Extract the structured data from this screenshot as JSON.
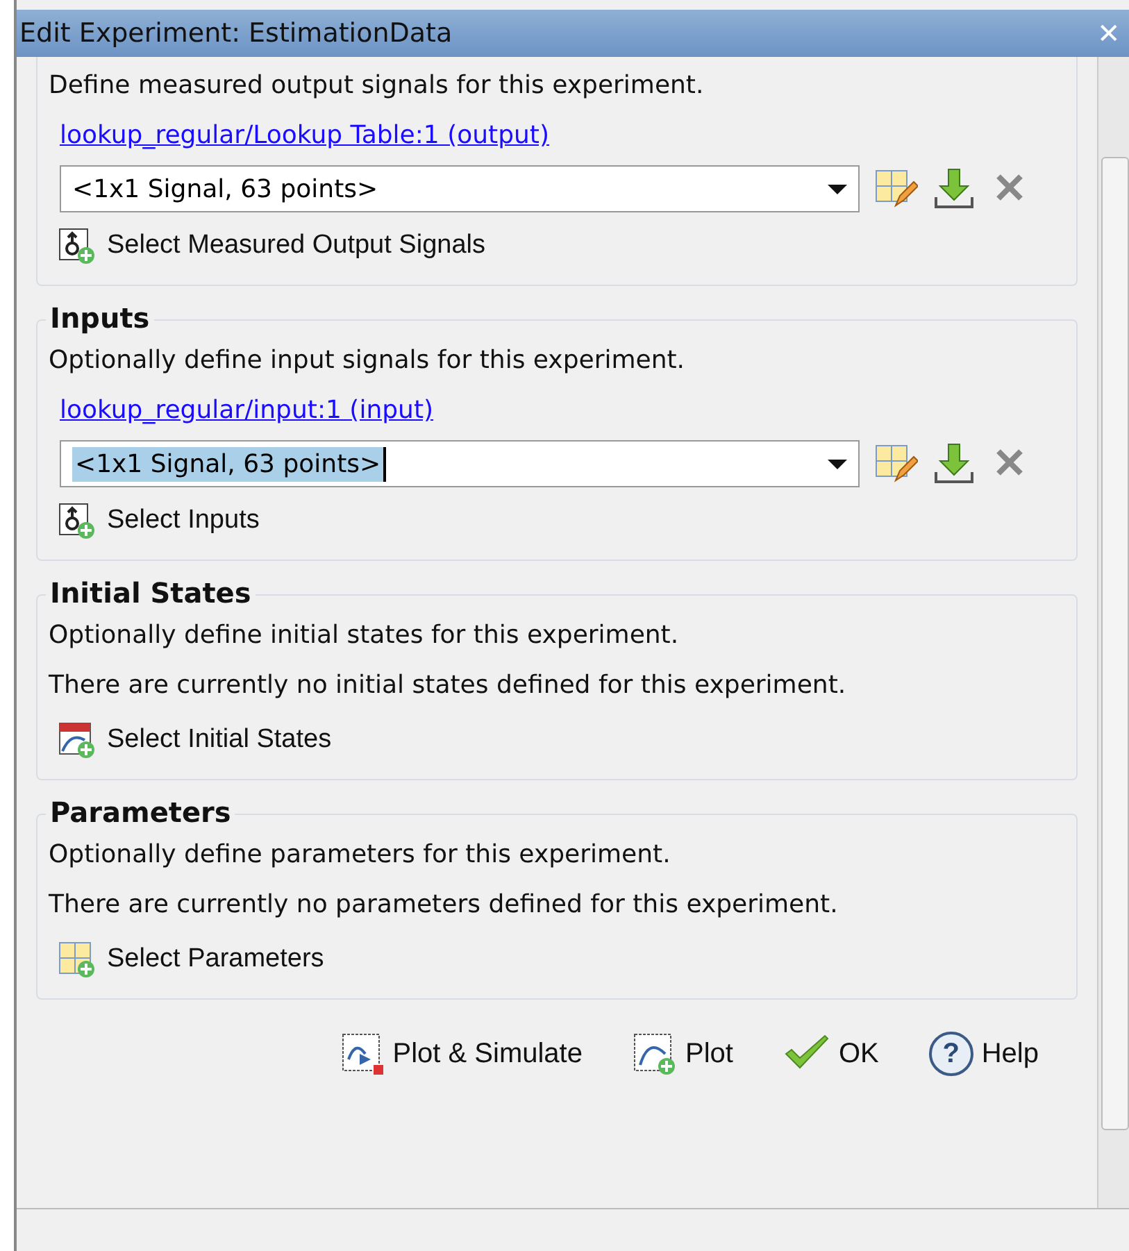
{
  "window": {
    "title": "Edit Experiment: EstimationData",
    "close": "✕"
  },
  "sections": [
    {
      "rows": [
        {
          "kind": "text",
          "text": "Define measured output signals for this experiment."
        },
        {
          "kind": "link",
          "text": "lookup_regular/Lookup Table:1 (output)"
        },
        {
          "kind": "combo",
          "value": "<1x1 Signal, 63 points>",
          "text_selected": false
        },
        {
          "kind": "action_signals",
          "text": "Select Measured Output Signals"
        }
      ]
    },
    {
      "title": "Inputs",
      "rows": [
        {
          "kind": "text",
          "text": "Optionally define input signals for this experiment."
        },
        {
          "kind": "link",
          "text": "lookup_regular/input:1 (input)"
        },
        {
          "kind": "combo",
          "value": "<1x1 Signal, 63 points>",
          "text_selected": true
        },
        {
          "kind": "action_signals",
          "text": "Select Inputs"
        }
      ]
    },
    {
      "title": "Initial States",
      "rows": [
        {
          "kind": "text",
          "text": "Optionally define initial states for this experiment."
        },
        {
          "kind": "text",
          "text": "There are currently no initial states defined for this experiment."
        },
        {
          "kind": "action_states",
          "text": "Select Initial States"
        }
      ]
    },
    {
      "title": "Parameters",
      "rows": [
        {
          "kind": "text",
          "text": "Optionally define parameters for this experiment."
        },
        {
          "kind": "text",
          "text": "There are currently no parameters defined for this experiment."
        },
        {
          "kind": "action_parameters",
          "text": "Select Parameters"
        }
      ]
    }
  ],
  "buttons": [
    {
      "kind": "plot_simulate",
      "label": "Plot & Simulate"
    },
    {
      "kind": "plot",
      "label": "Plot"
    },
    {
      "kind": "ok",
      "label": "OK"
    },
    {
      "kind": "help",
      "label": "Help",
      "glyph": "?"
    }
  ]
}
